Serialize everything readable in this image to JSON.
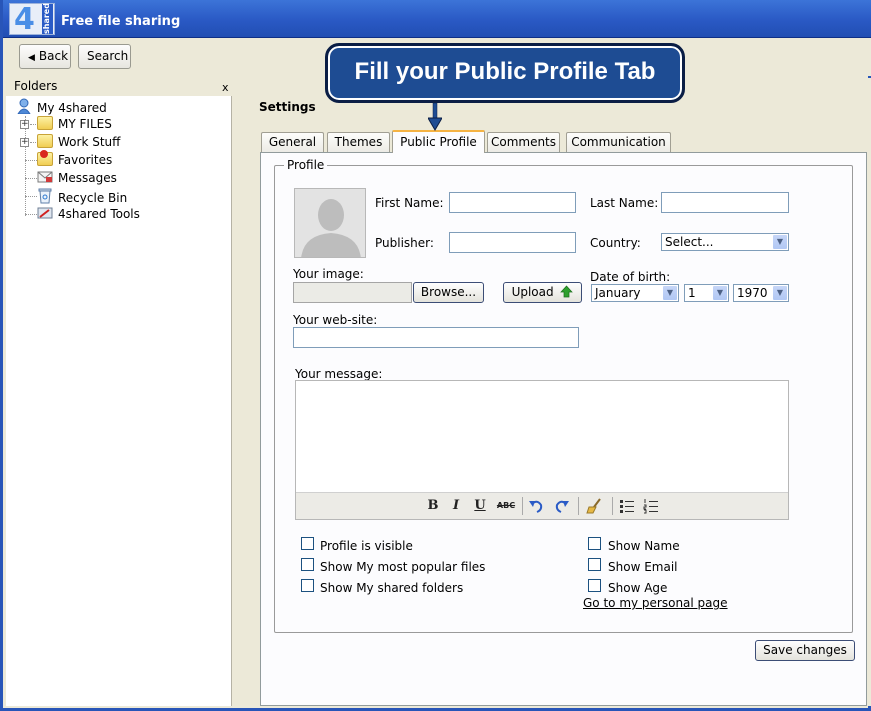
{
  "app": {
    "title": "Free file sharing",
    "logo_number": "4",
    "logo_text": "shared"
  },
  "toolbar": {
    "back_label": "Back",
    "search_label": "Search"
  },
  "callout": {
    "text": "Fill your Public Profile Tab"
  },
  "sidebar": {
    "title": "Folders",
    "close_label": "x",
    "items": [
      {
        "label": "My 4shared",
        "icon": "user-icon"
      },
      {
        "label": "MY FILES",
        "icon": "folder-icon"
      },
      {
        "label": "Work Stuff",
        "icon": "folder-icon"
      },
      {
        "label": "Favorites",
        "icon": "favorites-icon"
      },
      {
        "label": "Messages",
        "icon": "messages-icon"
      },
      {
        "label": "Recycle Bin",
        "icon": "recycle-bin-icon"
      },
      {
        "label": "4shared Tools",
        "icon": "tools-icon"
      }
    ]
  },
  "main": {
    "title": "Settings",
    "tabs": [
      {
        "label": "General"
      },
      {
        "label": "Themes"
      },
      {
        "label": "Public Profile",
        "active": true
      },
      {
        "label": "Comments"
      },
      {
        "label": "Communication"
      }
    ]
  },
  "profile": {
    "legend": "Profile",
    "first_name_label": "First Name:",
    "first_name_value": "",
    "last_name_label": "Last Name:",
    "last_name_value": "",
    "publisher_label": "Publisher:",
    "publisher_value": "",
    "country_label": "Country:",
    "country_value": "Select...",
    "image_label": "Your image:",
    "browse_label": "Browse...",
    "upload_label": "Upload",
    "dob_label": "Date of birth:",
    "dob_month": "January",
    "dob_day": "1",
    "dob_year": "1970",
    "website_label": "Your web-site:",
    "website_value": "",
    "message_label": "Your message:",
    "message_value": "",
    "editor_tools": {
      "bold": "B",
      "italic": "I",
      "underline": "U",
      "strike": "ABC"
    },
    "checkboxes_left": [
      {
        "label": "Profile is visible",
        "checked": false
      },
      {
        "label": "Show My most popular files",
        "checked": false
      },
      {
        "label": "Show My shared folders",
        "checked": false
      }
    ],
    "checkboxes_right": [
      {
        "label": "Show Name",
        "checked": false
      },
      {
        "label": "Show Email",
        "checked": false
      },
      {
        "label": "Show Age",
        "checked": false
      }
    ],
    "personal_link": "Go to my personal page",
    "save_label": "Save changes"
  },
  "colors": {
    "titlebar": "#2a59c4",
    "callout": "#1e4c93",
    "active_tab_accent": "#f5b343",
    "upload_arrow": "#2ea02e"
  }
}
